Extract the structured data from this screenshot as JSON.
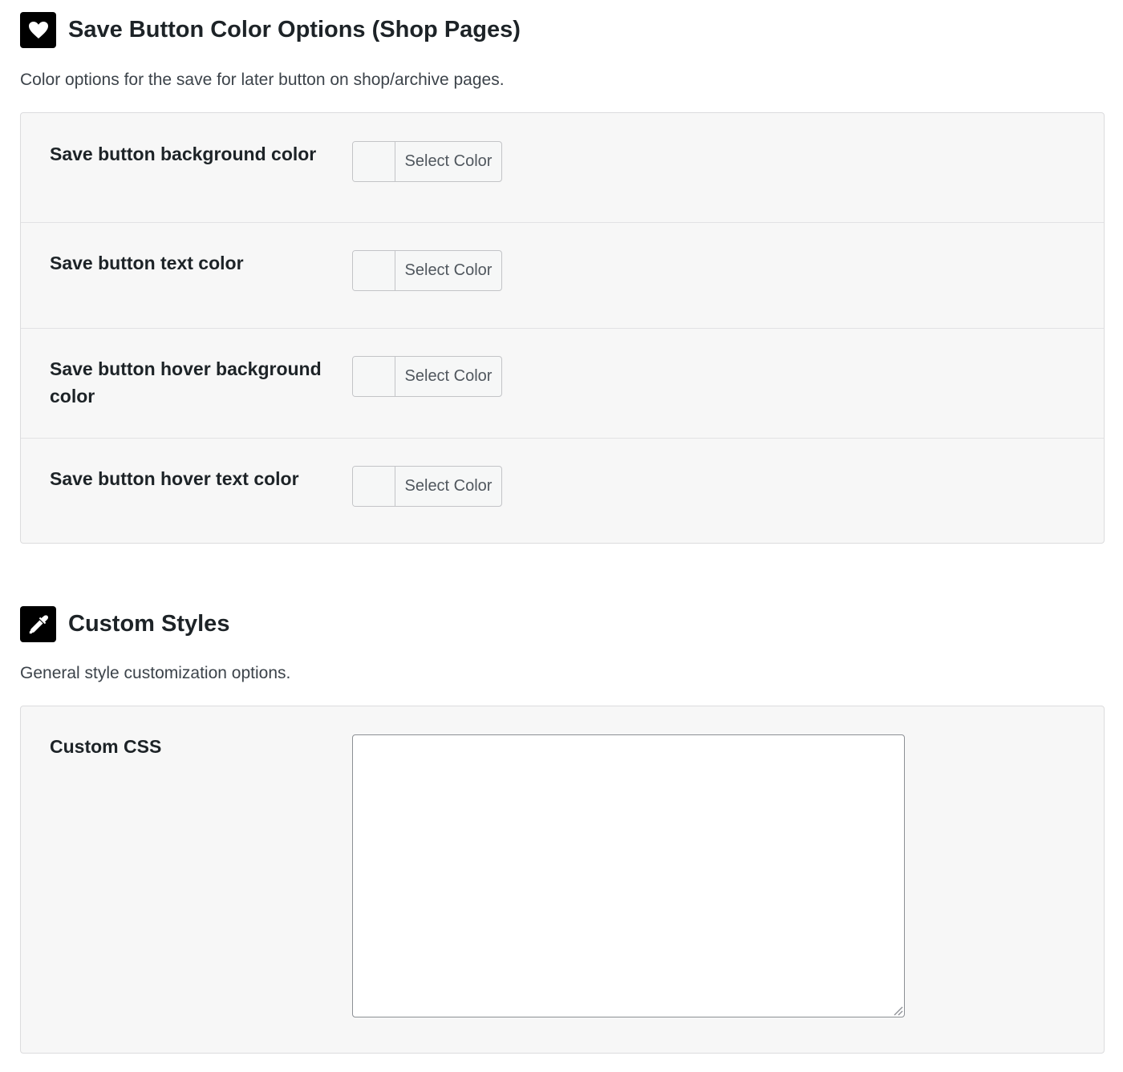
{
  "sections": [
    {
      "title": "Save Button Color Options (Shop Pages)",
      "icon": "heart-icon",
      "description": "Color options for the save for later button on shop/archive pages.",
      "fields": [
        {
          "label": "Save button background color",
          "button_label": "Select Color",
          "value": ""
        },
        {
          "label": "Save button text color",
          "button_label": "Select Color",
          "value": ""
        },
        {
          "label": "Save button hover background color",
          "button_label": "Select Color",
          "value": ""
        },
        {
          "label": "Save button hover text color",
          "button_label": "Select Color",
          "value": ""
        }
      ]
    },
    {
      "title": "Custom Styles",
      "icon": "eyedropper-icon",
      "description": "General style customization options.",
      "fields": [
        {
          "label": "Custom CSS",
          "value": ""
        }
      ]
    }
  ],
  "colors": {
    "panel_background": "#f7f7f7",
    "icon_background": "#000000",
    "text": "#1d2327"
  }
}
